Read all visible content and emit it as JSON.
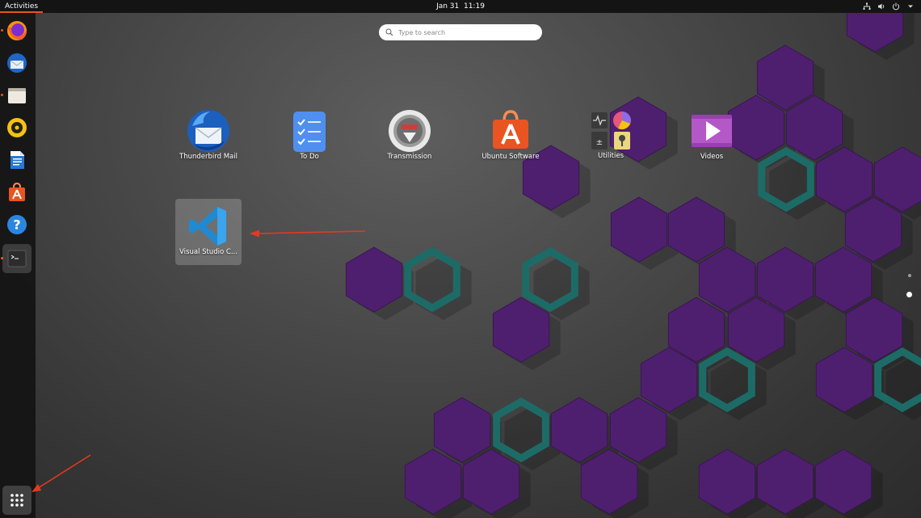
{
  "topbar": {
    "activities": "Activities",
    "date": "Jan 31",
    "time": "11:19",
    "tray_icons": [
      "network-icon",
      "volume-icon",
      "power-icon",
      "chevron-down-icon"
    ]
  },
  "search": {
    "placeholder": "Type to search"
  },
  "apps": [
    {
      "label": "Thunderbird Mail",
      "icon": "thunderbird-icon"
    },
    {
      "label": "To Do",
      "icon": "todo-icon"
    },
    {
      "label": "Transmission",
      "icon": "transmission-icon"
    },
    {
      "label": "Ubuntu Software",
      "icon": "ubuntu-software-icon"
    },
    {
      "label": "Utilities",
      "icon": "utilities-folder-icon"
    },
    {
      "label": "Videos",
      "icon": "videos-icon"
    },
    {
      "label": "Visual Studio C...",
      "icon": "vscode-icon",
      "selected": true
    }
  ],
  "dock": {
    "items": [
      "firefox-icon",
      "thunderbird-icon",
      "files-icon",
      "rhythmbox-icon",
      "libreoffice-writer-icon",
      "ubuntu-software-icon",
      "help-icon",
      "terminal-icon"
    ],
    "show_apps": "show-applications-icon"
  },
  "pages": {
    "count": 2,
    "current": 2
  },
  "colors": {
    "accent": "#e95420",
    "hex_purple": "#4f1f6f",
    "hex_teal": "#1d6b66",
    "arrow": "#e8381e"
  }
}
